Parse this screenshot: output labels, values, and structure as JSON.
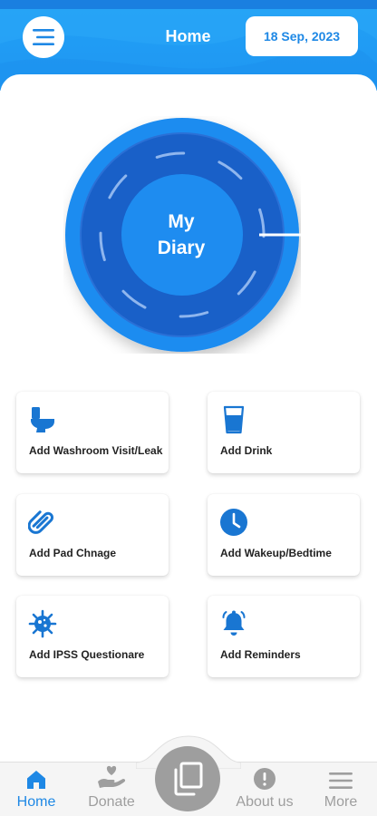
{
  "header": {
    "title": "Home",
    "date": "18 Sep, 2023",
    "menu_icon": "menu-icon"
  },
  "diary": {
    "line1": "My",
    "line2": "Diary",
    "indicator_icon": "dial-pointer-icon"
  },
  "actions": [
    {
      "label": "Add Washroom Visit/Leak",
      "icon": "toilet-icon"
    },
    {
      "label": "Add Drink",
      "icon": "glass-icon"
    },
    {
      "label": "Add Pad Chnage",
      "icon": "paperclip-icon"
    },
    {
      "label": "Add Wakeup/Bedtime",
      "icon": "clock-icon"
    },
    {
      "label": "Add IPSS Questionare",
      "icon": "virus-icon"
    },
    {
      "label": "Add Reminders",
      "icon": "bell-icon"
    }
  ],
  "bottom_nav": {
    "items": [
      {
        "label": "Home",
        "icon": "home-icon",
        "active": true
      },
      {
        "label": "Donate",
        "icon": "donate-hand-heart-icon",
        "active": false
      },
      {
        "label": "About us",
        "icon": "info-alert-icon",
        "active": false
      },
      {
        "label": "More",
        "icon": "hamburger-icon",
        "active": false
      }
    ],
    "center_icon": "copy-pages-icon"
  },
  "colors": {
    "primary": "#1e88e5",
    "header": "#22a0f5",
    "icon_blue": "#1976d2",
    "inactive": "#9e9e9e"
  }
}
